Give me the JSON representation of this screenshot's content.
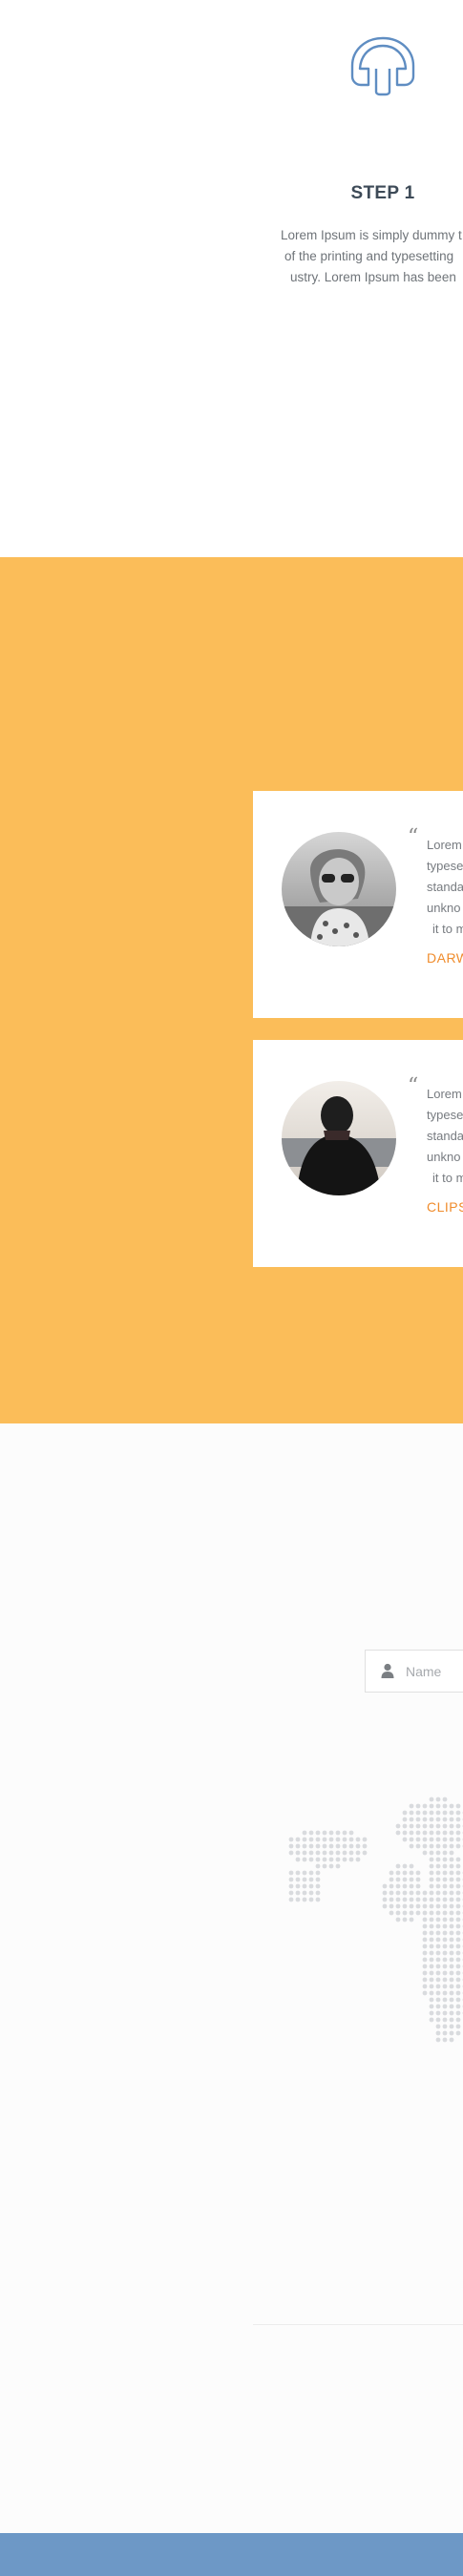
{
  "step": {
    "icon": "headphones-icon",
    "title": "STEP 1",
    "lines": [
      "Lorem Ipsum is simply dummy t",
      "of the printing and typesetting",
      "ustry. Lorem Ipsum has been"
    ]
  },
  "testimonials": [
    {
      "avatar": "woman-sunglasses-photo",
      "quote_lines": [
        "Lorem",
        "typese",
        "standa",
        "unkno",
        "it to m"
      ],
      "author": "DARW"
    },
    {
      "avatar": "man-hooded-photo",
      "quote_lines": [
        "Lorem",
        "typese",
        "standa",
        "unkno",
        "it to m"
      ],
      "author": "CLIPS"
    }
  ],
  "contact": {
    "name_placeholder": "Name",
    "user_icon": "user-icon",
    "map": "dotted-world-map"
  },
  "colors": {
    "accent_yellow": "#fbbd59",
    "author_orange": "#f08c2c",
    "footer_blue": "#6d98c6",
    "icon_blue": "#5f8dc2"
  }
}
